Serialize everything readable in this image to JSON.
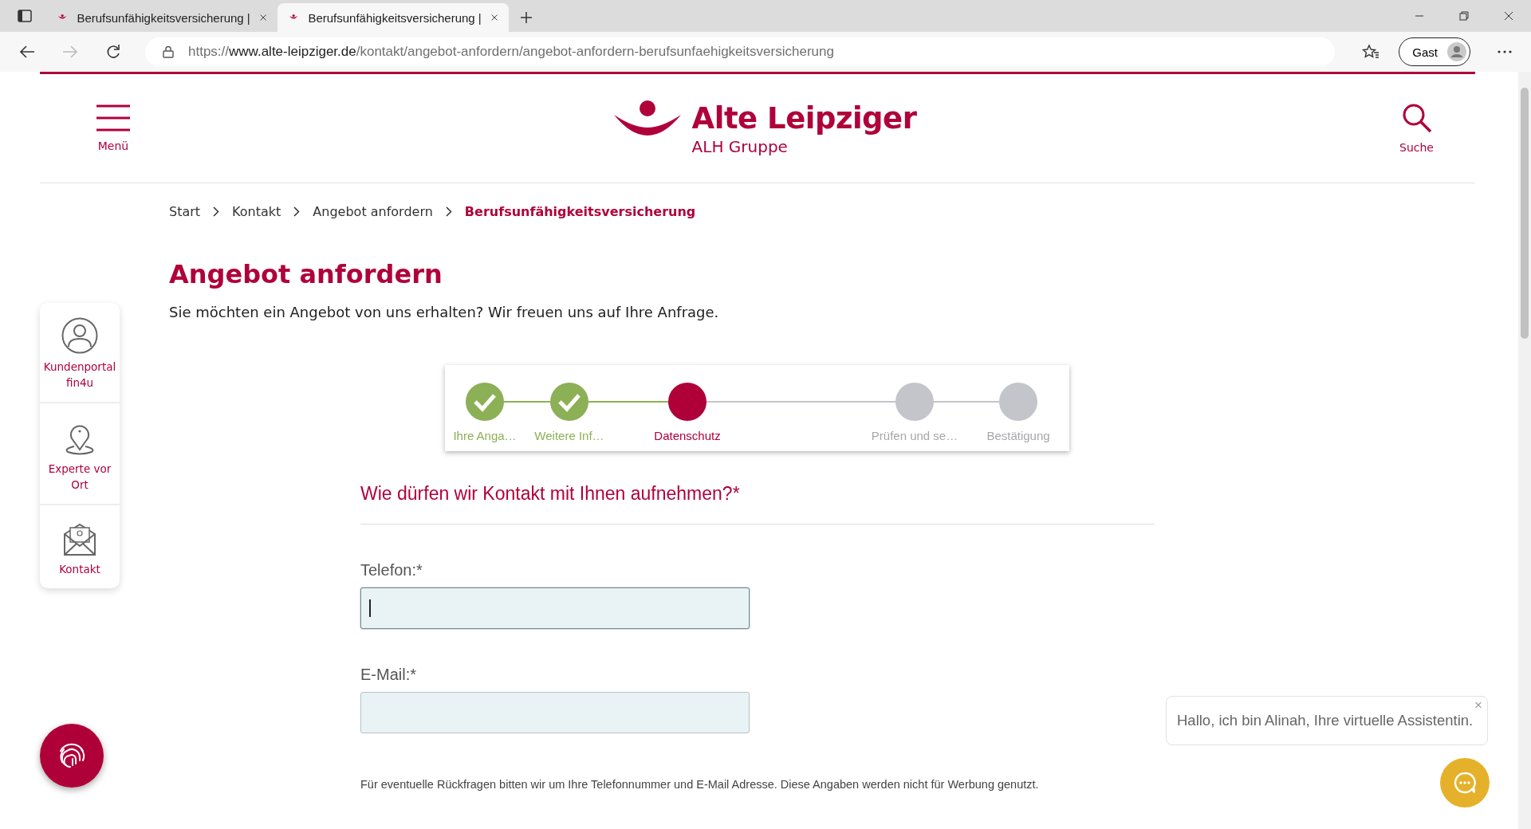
{
  "browser": {
    "tabs": [
      {
        "title": "Berufsunfähigkeitsversicherung |",
        "selected": false
      },
      {
        "title": "Berufsunfähigkeitsversicherung |",
        "selected": true
      }
    ],
    "url": {
      "scheme": "https://",
      "host": "www.alte-leipziger.de",
      "path": "/kontakt/angebot-anfordern/angebot-anfordern-berufsunfaehigkeitsversicherung"
    },
    "profile": "Gast"
  },
  "header": {
    "menu_label": "Menü",
    "brand": "Alte Leipziger",
    "brand_sub": "ALH Gruppe",
    "search_label": "Suche"
  },
  "breadcrumb": [
    {
      "label": "Start",
      "current": false
    },
    {
      "label": "Kontakt",
      "current": false
    },
    {
      "label": "Angebot anfordern",
      "current": false
    },
    {
      "label": "Berufsunfähigkeitsversicherung",
      "current": true
    }
  ],
  "title": "Angebot anfordern",
  "intro": "Sie möchten ein Angebot von uns erhalten? Wir freuen uns auf Ihre Anfrage.",
  "side_nav": [
    {
      "kind": "person",
      "label": "Kundenportal fin4u"
    },
    {
      "kind": "pin",
      "label": "Experte vor Ort"
    },
    {
      "kind": "mail",
      "label": "Kontakt"
    }
  ],
  "steps": [
    {
      "label": "Ihre Anga…",
      "done": true,
      "current": false
    },
    {
      "label": "Weitere Inf…",
      "done": true,
      "current": false
    },
    {
      "label": "Datenschutz",
      "done": false,
      "current": true
    },
    {
      "label": "Prüfen und se…",
      "done": false,
      "current": false
    },
    {
      "label": "Bestätigung",
      "done": false,
      "current": false
    }
  ],
  "question": "Wie dürfen wir Kontakt mit Ihnen aufnehmen?*",
  "fields": [
    {
      "label": "Telefon:*",
      "focused": true
    },
    {
      "label": "E-Mail:*",
      "focused": false
    }
  ],
  "note": "Für eventuelle Rückfragen bitten wir um Ihre Telefonnummer und E-Mail Adresse. Diese Angaben werden nicht für Werbung genutzt.",
  "chat": {
    "message": "Hallo, ich bin Alinah, Ihre virtuelle Assistentin.",
    "close": "×"
  }
}
